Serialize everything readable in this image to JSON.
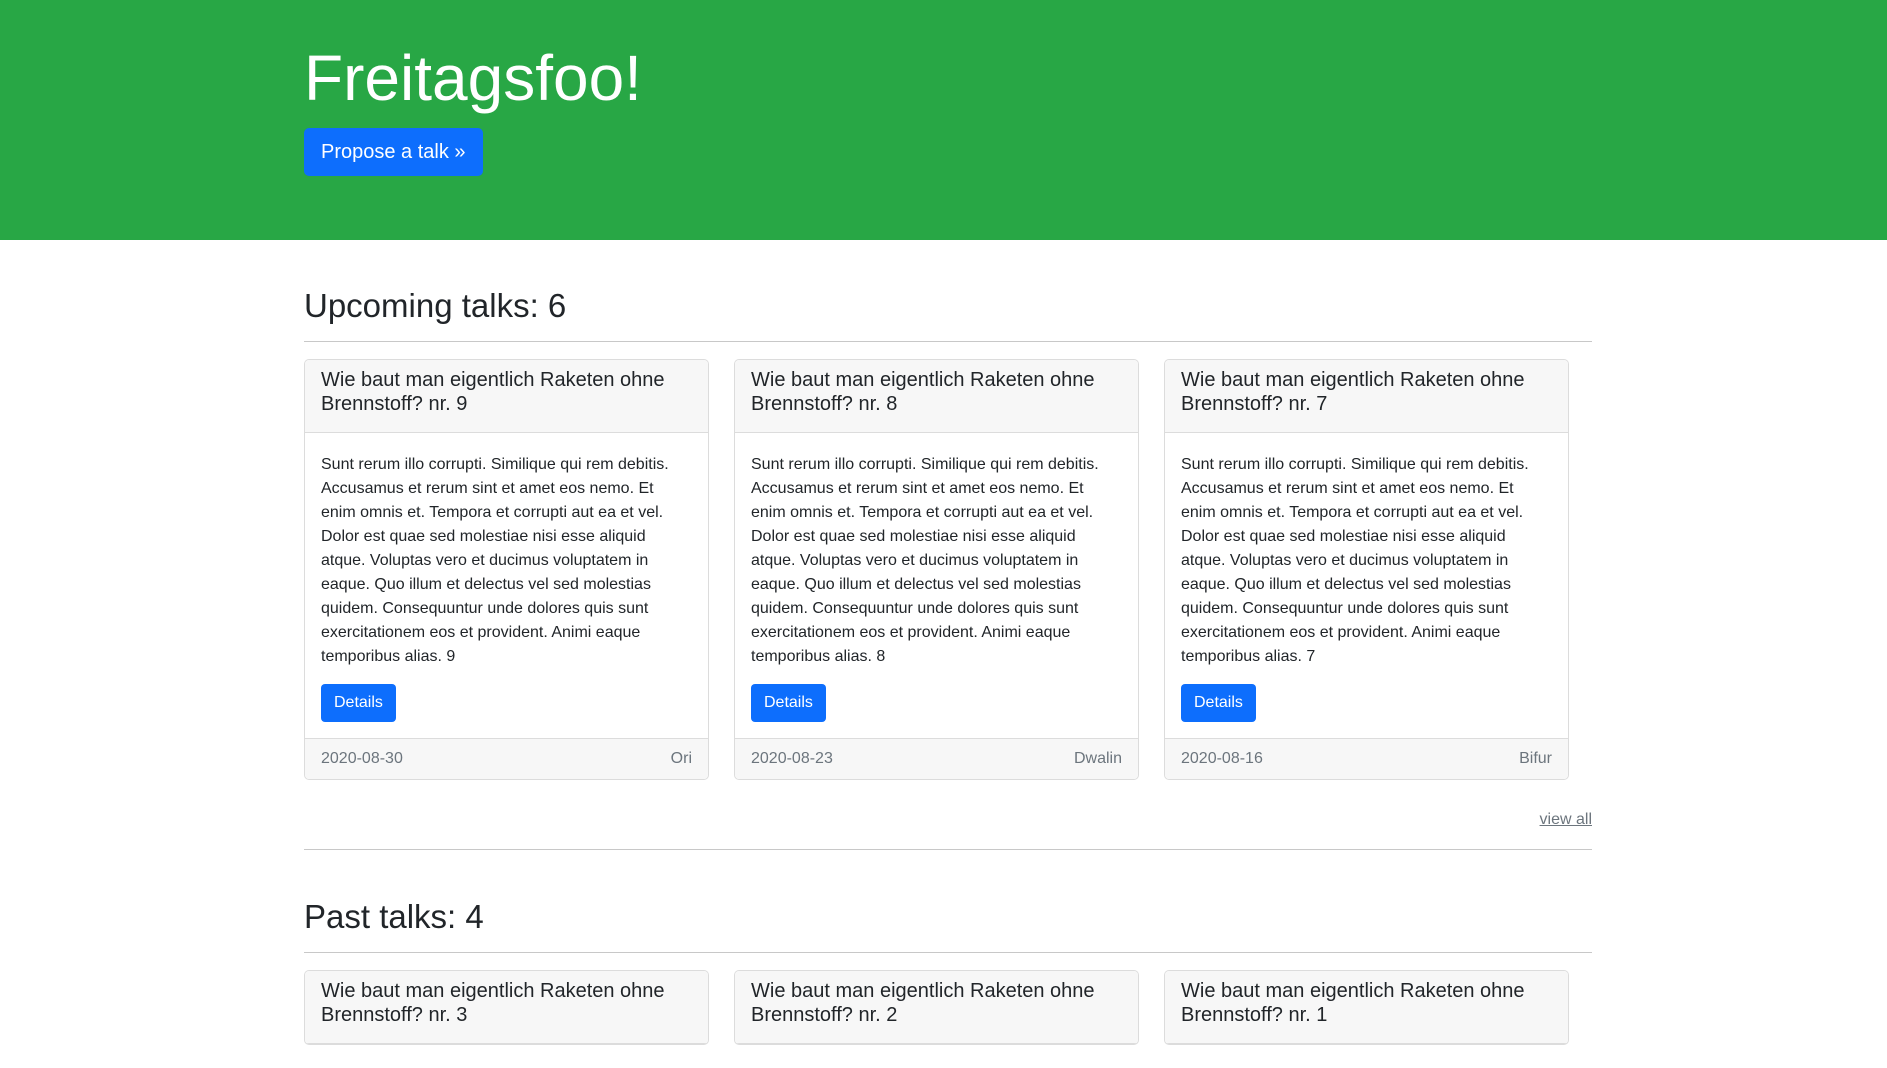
{
  "hero": {
    "title": "Freitagsfoo!",
    "propose_label": "Propose a talk »"
  },
  "colors": {
    "hero_bg": "#28a745",
    "primary": "#0d6efd"
  },
  "upcoming": {
    "title": "Upcoming talks: 6",
    "view_all": "view all",
    "talks": [
      {
        "title": "Wie baut man eigentlich Raketen ohne Brennstoff? nr. 9",
        "text": "Sunt rerum illo corrupti. Similique qui rem debitis. Accusamus et rerum sint et amet eos nemo. Et enim omnis et. Tempora et corrupti aut ea et vel. Dolor est quae sed molestiae nisi esse aliquid atque. Voluptas vero et ducimus voluptatem in eaque. Quo illum et delectus vel sed molestias quidem. Consequuntur unde dolores quis sunt exercitationem eos et provident. Animi eaque temporibus alias. 9",
        "button": "Details",
        "date": "2020-08-30",
        "speaker": "Ori"
      },
      {
        "title": "Wie baut man eigentlich Raketen ohne Brennstoff? nr. 8",
        "text": "Sunt rerum illo corrupti. Similique qui rem debitis. Accusamus et rerum sint et amet eos nemo. Et enim omnis et. Tempora et corrupti aut ea et vel. Dolor est quae sed molestiae nisi esse aliquid atque. Voluptas vero et ducimus voluptatem in eaque. Quo illum et delectus vel sed molestias quidem. Consequuntur unde dolores quis sunt exercitationem eos et provident. Animi eaque temporibus alias. 8",
        "button": "Details",
        "date": "2020-08-23",
        "speaker": "Dwalin"
      },
      {
        "title": "Wie baut man eigentlich Raketen ohne Brennstoff? nr. 7",
        "text": "Sunt rerum illo corrupti. Similique qui rem debitis. Accusamus et rerum sint et amet eos nemo. Et enim omnis et. Tempora et corrupti aut ea et vel. Dolor est quae sed molestiae nisi esse aliquid atque. Voluptas vero et ducimus voluptatem in eaque. Quo illum et delectus vel sed molestias quidem. Consequuntur unde dolores quis sunt exercitationem eos et provident. Animi eaque temporibus alias. 7",
        "button": "Details",
        "date": "2020-08-16",
        "speaker": "Bifur"
      }
    ]
  },
  "past": {
    "title": "Past talks: 4",
    "talks": [
      {
        "title": "Wie baut man eigentlich Raketen ohne Brennstoff? nr. 3"
      },
      {
        "title": "Wie baut man eigentlich Raketen ohne Brennstoff? nr. 2"
      },
      {
        "title": "Wie baut man eigentlich Raketen ohne Brennstoff? nr. 1"
      }
    ]
  }
}
